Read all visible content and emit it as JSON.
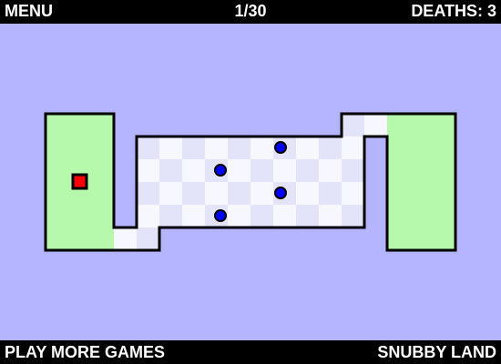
{
  "header": {
    "menu_label": "MENU",
    "level_label": "1/30",
    "deaths_label": "DEATHS: 3"
  },
  "footer": {
    "more_games_label": "PLAY MORE GAMES",
    "brand_label": "SNUBBY LAND"
  },
  "game": {
    "player": {
      "shape": "red-square"
    },
    "enemy_count": 4,
    "colors": {
      "background": "#b4b5fe",
      "start_zone": "#b6f9ad",
      "finish_zone": "#b6f9ad",
      "tile_light": "#f7f7ff",
      "tile_dark": "#e3e3fa",
      "player": "#ff0000",
      "enemy": "#0000ff",
      "outline": "#000000",
      "bar": "#000000",
      "bar_text": "#ffffff"
    }
  }
}
